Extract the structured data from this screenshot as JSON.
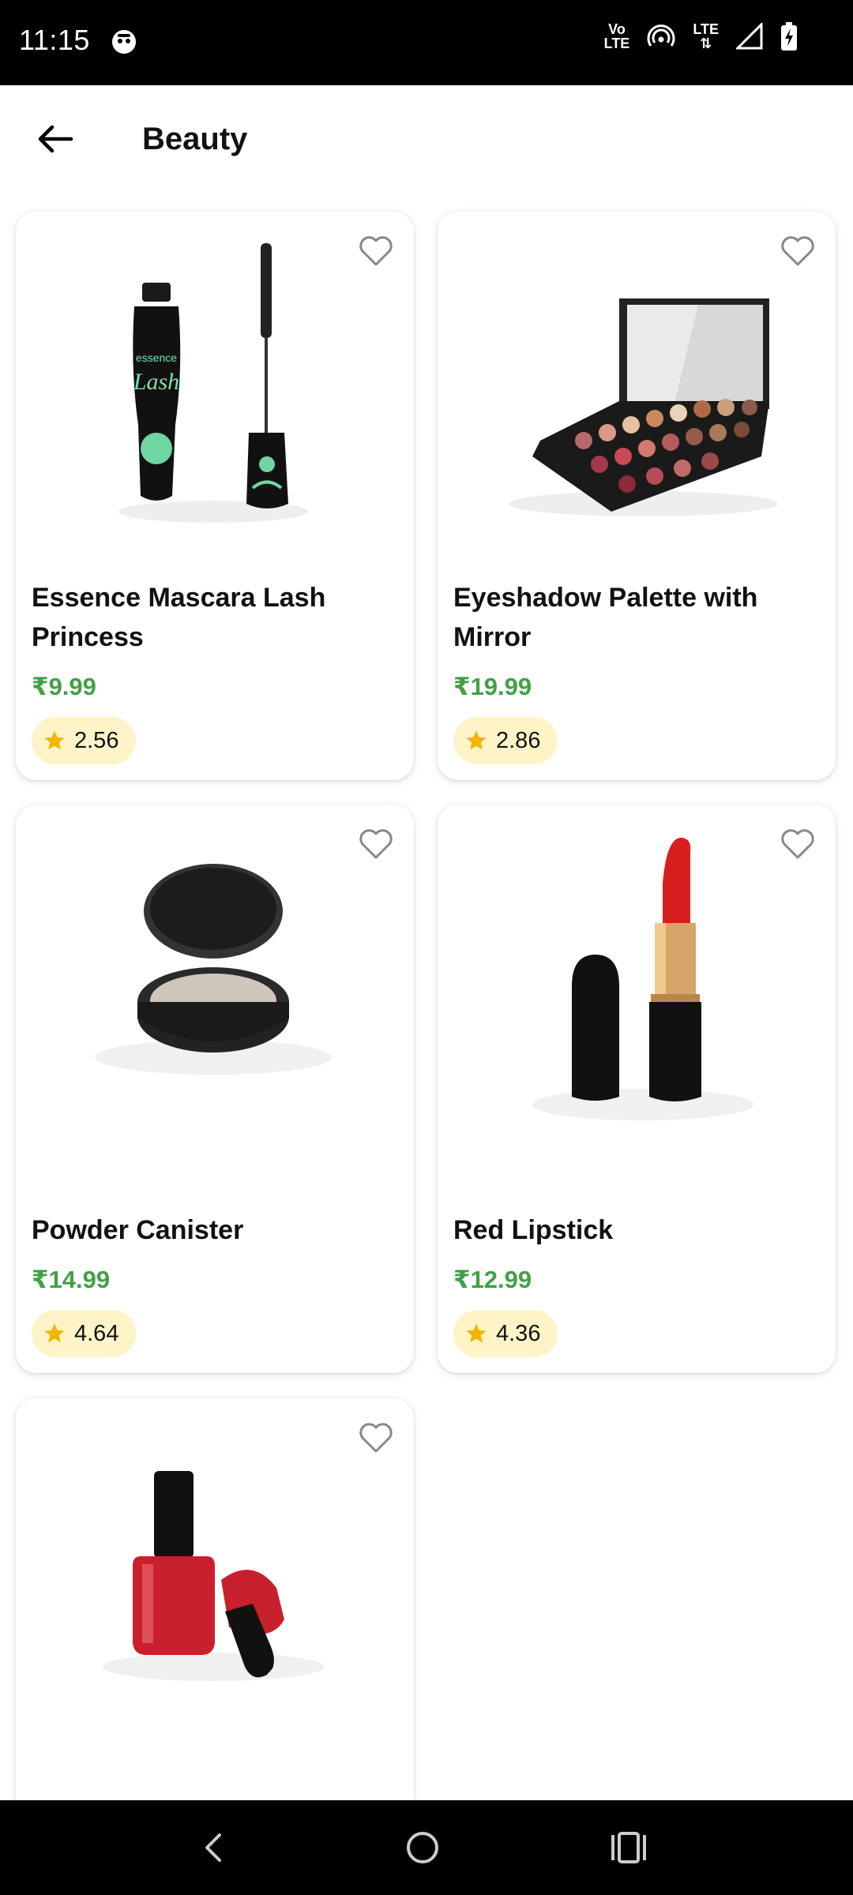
{
  "status_bar": {
    "time": "11:15",
    "volte_top": "Vo",
    "volte_bottom": "LTE",
    "lte": "LTE"
  },
  "app_bar": {
    "title": "Beauty"
  },
  "colors": {
    "price": "#43a047",
    "rating_bg": "#fff3c8",
    "star": "#f4b400"
  },
  "products": [
    {
      "name": "Essence Mascara Lash Princess",
      "price": "₹9.99",
      "rating": "2.56",
      "image": "mascara-image"
    },
    {
      "name": "Eyeshadow Palette with Mirror",
      "price": "₹19.99",
      "rating": "2.86",
      "image": "eyeshadow-palette-image"
    },
    {
      "name": "Powder Canister",
      "price": "₹14.99",
      "rating": "4.64",
      "image": "powder-canister-image"
    },
    {
      "name": "Red Lipstick",
      "price": "₹12.99",
      "rating": "4.36",
      "image": "red-lipstick-image"
    },
    {
      "name": "",
      "price": "",
      "rating": "",
      "image": "red-nail-polish-image"
    }
  ]
}
